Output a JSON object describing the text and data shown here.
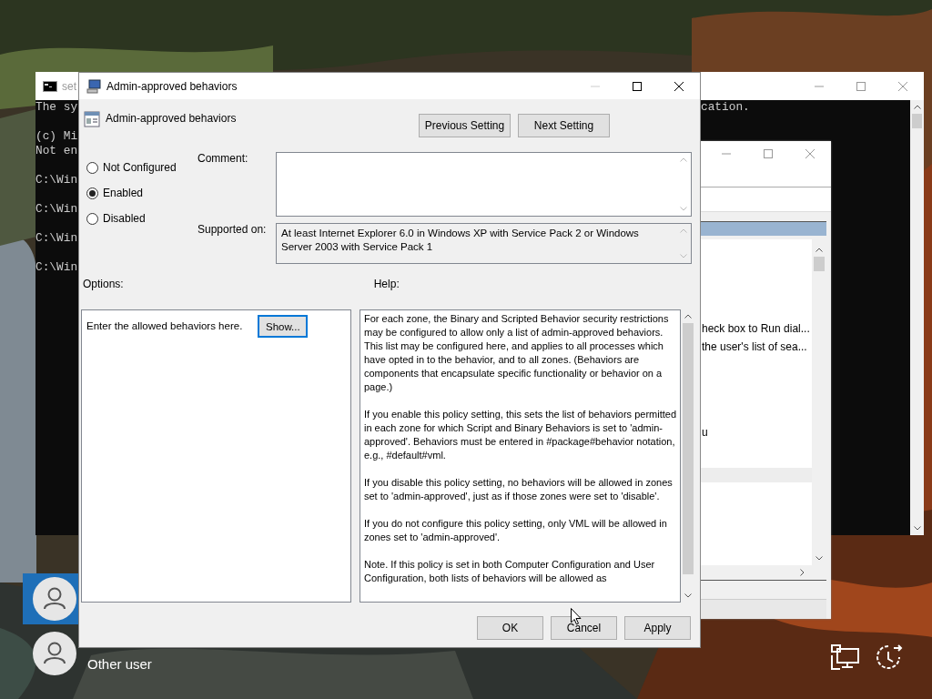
{
  "cmd_window": {
    "title": "set",
    "lines": [
      "The sy",
      "(c) Mi",
      "Not en",
      "C:\\Win",
      "C:\\Win",
      "C:\\Win",
      "C:\\Win"
    ],
    "right_text": "cation."
  },
  "background_window": {
    "rows": [
      {
        "text": "heck box to Run dial..."
      },
      {
        "text": "the user's list of sea..."
      },
      {
        "text": "u"
      }
    ]
  },
  "users": [
    {
      "selected": true
    },
    {
      "name": "Other user",
      "selected": false
    }
  ],
  "dialog": {
    "title": "Admin-approved behaviors",
    "setting_name": "Admin-approved behaviors",
    "nav_buttons": [
      "Previous Setting",
      "Next Setting"
    ],
    "states": [
      {
        "label": "Not Configured",
        "selected": false
      },
      {
        "label": "Enabled",
        "selected": true
      },
      {
        "label": "Disabled",
        "selected": false
      }
    ],
    "comment": {
      "label": "Comment:"
    },
    "supported_on": {
      "label": "Supported on:",
      "value": "At least Internet Explorer 6.0 in Windows XP with Service Pack 2 or Windows Server 2003 with Service Pack 1"
    },
    "options": {
      "label": "Options:",
      "prompt": "Enter the allowed behaviors here.",
      "button": {
        "label": "Show...",
        "focused": true
      }
    },
    "help": {
      "label": "Help:",
      "paragraphs": [
        "For each zone, the Binary and Scripted Behavior security restrictions may be configured to allow only a list of admin-approved behaviors. This list may be configured here, and applies to all processes which have opted in to the behavior, and to all zones. (Behaviors are components that encapsulate specific functionality or behavior on a page.)",
        "If you enable this policy setting, this sets the list of behaviors permitted in each zone for which Script and Binary Behaviors is set to 'admin-approved'. Behaviors must be entered in #package#behavior notation, e.g., #default#vml.",
        "If you disable this policy setting, no behaviors will be allowed in zones set to 'admin-approved', just as if those zones were set to 'disable'.",
        "If you do not configure this policy setting, only VML will be allowed in zones set to 'admin-approved'.",
        "Note.  If this policy is set in both Computer Configuration and User Configuration, both lists of behaviors will be allowed as"
      ]
    },
    "buttons": [
      "OK",
      "Cancel",
      "Apply"
    ]
  }
}
